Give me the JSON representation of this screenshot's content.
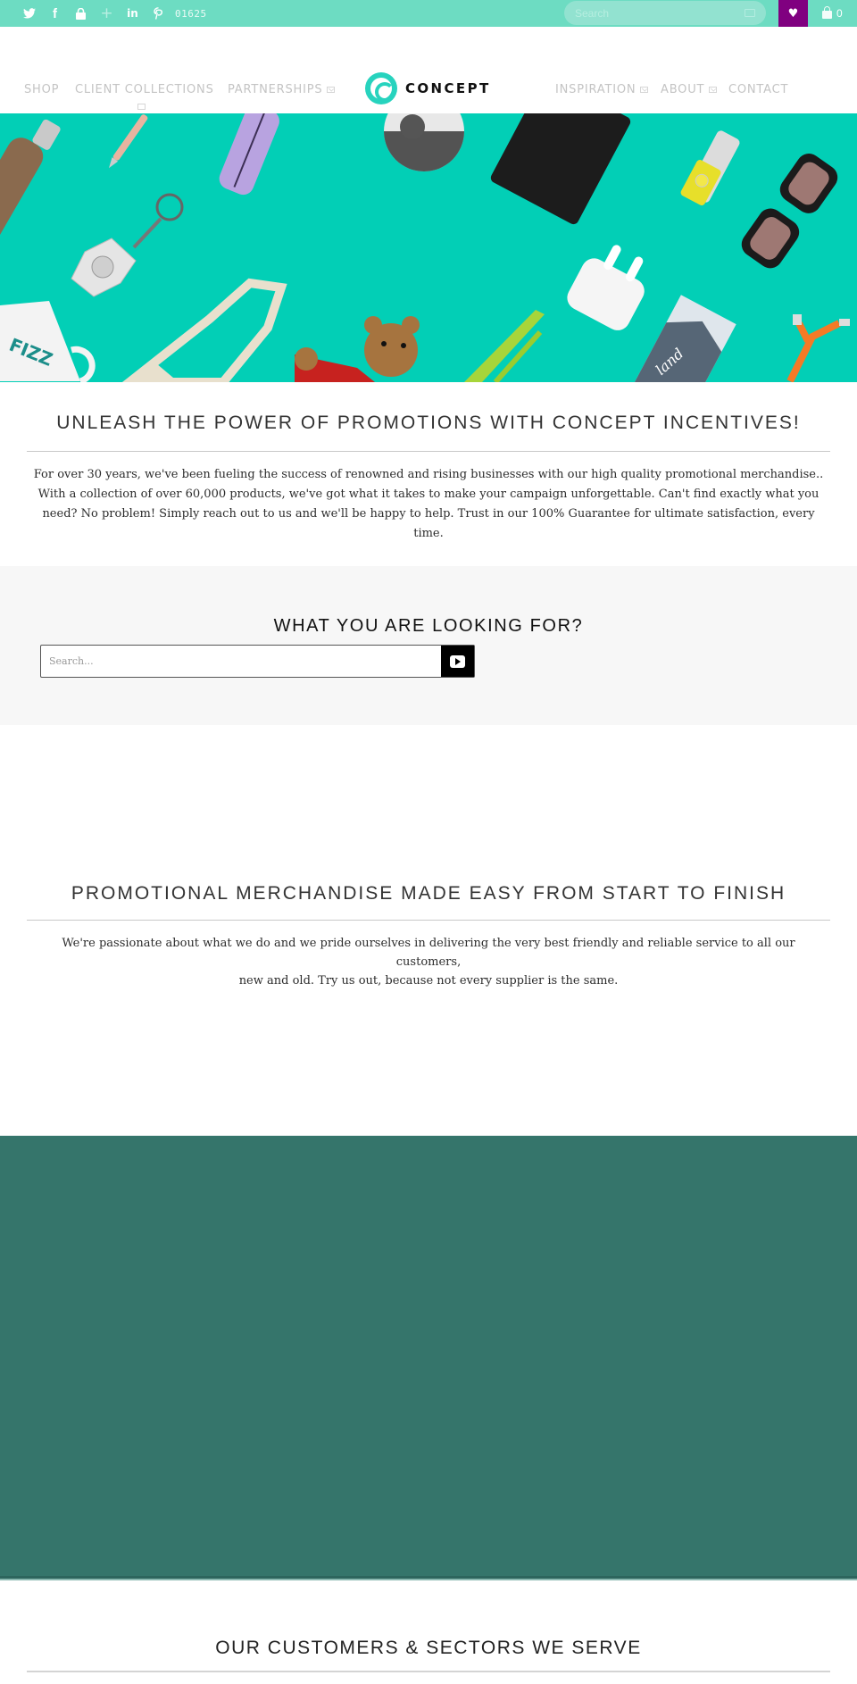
{
  "topbar": {
    "social": [
      {
        "name": "twitter",
        "glyph": "🐦"
      },
      {
        "name": "facebook",
        "glyph": "f"
      },
      {
        "name": "lock",
        "glyph": "🔒"
      },
      {
        "name": "plus",
        "glyph": "+"
      },
      {
        "name": "linkedin",
        "glyph": "in"
      },
      {
        "name": "pinterest",
        "glyph": "P"
      }
    ],
    "phone": "01625",
    "search_placeholder": "Search",
    "wishlist_glyph": "♥",
    "cart_count": "0",
    "colors": {
      "bar": "#6ddcc2",
      "wishlist": "#800080"
    }
  },
  "header": {
    "logo_text": "CONCEPT",
    "nav": [
      {
        "label": "SHOP",
        "has_dropdown": false
      },
      {
        "label": "CLIENT COLLECTIONS",
        "has_dropdown": true
      },
      {
        "label": "PARTNERSHIPS",
        "has_dropdown": true
      },
      {
        "label": "INSPIRATION",
        "has_dropdown": true
      },
      {
        "label": "ABOUT",
        "has_dropdown": true
      },
      {
        "label": "CONTACT",
        "has_dropdown": false
      }
    ],
    "brand_color": "#27d3be"
  },
  "hero": {
    "background": "#02cfb6",
    "products": [
      "water bottle",
      "pen",
      "pencil case",
      "beach ball",
      "notebook",
      "usb stick",
      "sunglasses",
      "keyring",
      "earbuds",
      "mug",
      "tote bag",
      "teddy bear",
      "lanyard",
      "chocolate bar",
      "charging cable"
    ]
  },
  "intro": {
    "title": "UNLEASH THE POWER OF PROMOTIONS WITH CONCEPT INCENTIVES!",
    "lines": [
      "For over 30 years, we've been fueling the success of renowned and rising businesses with our high quality promotional merchandise..",
      "With a collection of over 60,000 products, we've got what it takes to make your campaign unforgettable. Can't find exactly what you",
      "need? No problem! Simply reach out to us and we'll be happy to help. Trust in our 100% Guarantee for ultimate satisfaction, every time."
    ]
  },
  "finder": {
    "title": "WHAT YOU ARE LOOKING FOR?",
    "placeholder": "Search..."
  },
  "easy": {
    "title": "PROMOTIONAL MERCHANDISE MADE EASY FROM START TO FINISH",
    "lines": [
      "We're passionate about what we do and we pride ourselves in delivering the very best friendly and reliable service to all our customers,",
      "new and old. Try us out, because not every supplier is the same."
    ]
  },
  "teal_block": {
    "color": "#35756b"
  },
  "customers": {
    "title": "OUR CUSTOMERS & SECTORS WE SERVE"
  }
}
